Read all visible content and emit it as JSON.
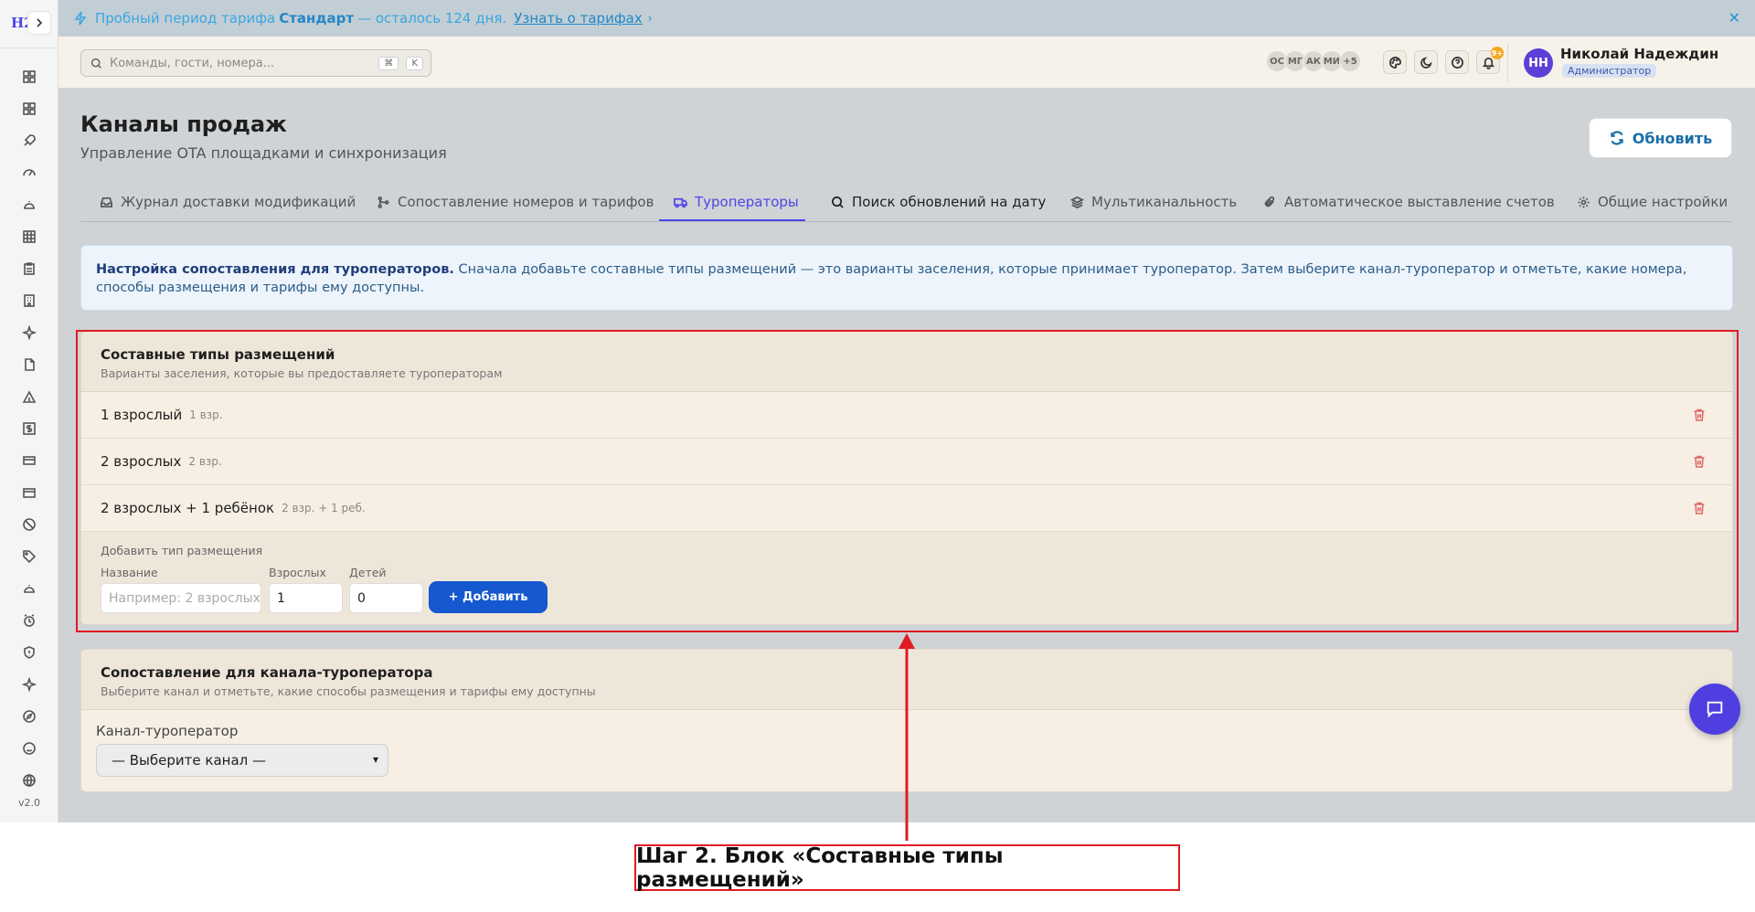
{
  "app": {
    "logo": "H2",
    "version": "v2.0"
  },
  "trial_banner": {
    "prefix": "Пробный период тарифа",
    "plan": "Стандарт",
    "suffix": "— осталось 124 дня.",
    "link": "Узнать о тарифах"
  },
  "header": {
    "search_placeholder": "Команды, гости, номера...",
    "kbd1": "⌘",
    "kbd2": "K",
    "avatars": [
      "ОС",
      "МГ",
      "АК",
      "МИ",
      "+5"
    ],
    "notif_count": "9+",
    "user_initials": "НН",
    "user_name": "Николай Надеждин",
    "user_role": "Администратор"
  },
  "page": {
    "title": "Каналы продаж",
    "subtitle": "Управление OTA площадками и синхронизация",
    "refresh_label": "Обновить"
  },
  "tabs": [
    {
      "label": "Журнал доставки модификаций",
      "icon": "inbox-icon"
    },
    {
      "label": "Сопоставление номеров и тарифов",
      "icon": "git-merge-icon"
    },
    {
      "label": "Туроператоры",
      "icon": "truck-icon"
    },
    {
      "label": "Поиск обновлений на дату",
      "icon": "search-icon"
    },
    {
      "label": "Мультиканальность",
      "icon": "layers-icon"
    },
    {
      "label": "Автоматическое выставление счетов",
      "icon": "paperclip-icon"
    },
    {
      "label": "Общие настройки",
      "icon": "gear-icon"
    }
  ],
  "info": {
    "bold": "Настройка сопоставления для туроператоров.",
    "text": "Сначала добавьте составные типы размещений — это варианты заселения, которые принимает туроператор. Затем выберите канал-туроператор и отметьте, какие номера, способы размещения и тарифы ему доступны."
  },
  "composite": {
    "title": "Составные типы размещений",
    "subtitle": "Варианты заселения, которые вы предоставляете туроператорам",
    "rows": [
      {
        "name": "1 взрослый",
        "meta": "1 взр."
      },
      {
        "name": "2 взрослых",
        "meta": "2 взр."
      },
      {
        "name": "2 взрослых + 1 ребёнок",
        "meta": "2 взр. + 1 реб."
      }
    ],
    "add_title": "Добавить тип размещения",
    "name_label": "Название",
    "name_placeholder": "Например: 2 взрослых",
    "adults_label": "Взрослых",
    "adults_value": "1",
    "children_label": "Детей",
    "children_value": "0",
    "add_button": "+ Добавить"
  },
  "mapping": {
    "title": "Сопоставление для канала-туроператора",
    "subtitle": "Выберите канал и отметьте, какие способы размещения и тарифы ему доступны",
    "channel_label": "Канал-туроператор",
    "channel_select": "— Выберите канал —"
  },
  "annotation": {
    "caption": "Шаг 2. Блок «Составные типы размещений»"
  },
  "colors": {
    "accent": "#4f46e5",
    "primary_button": "#1558cf",
    "highlight": "#e01b24"
  }
}
